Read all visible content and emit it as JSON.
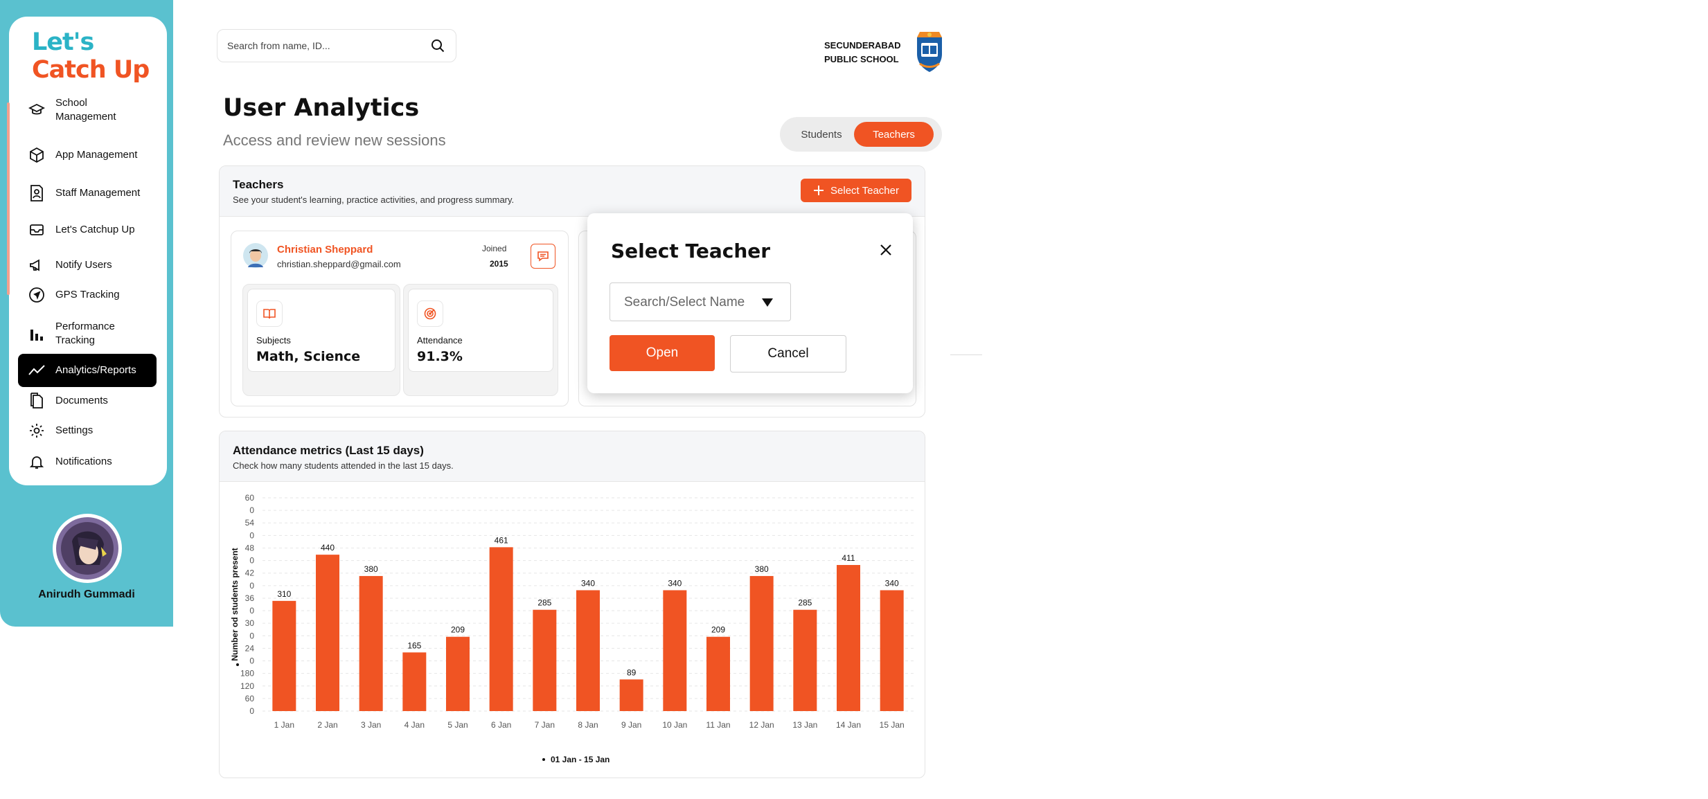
{
  "brand": {
    "line1": "Let's",
    "line2": "Catch Up"
  },
  "sidebar": {
    "items": [
      {
        "label": "School Management",
        "icon": "graduation-cap-icon"
      },
      {
        "label": "App Management",
        "icon": "cube-icon"
      },
      {
        "label": "Staff Management",
        "icon": "staff-badge-icon"
      },
      {
        "label": "Let's Catchup Up",
        "icon": "inbox-icon"
      },
      {
        "label": "Notify Users",
        "icon": "megaphone-icon"
      },
      {
        "label": "GPS Tracking",
        "icon": "navigation-icon"
      },
      {
        "label": "Performance Tracking",
        "icon": "bar-chart-icon"
      },
      {
        "label": "Analytics/Reports",
        "icon": "trend-line-icon",
        "active": true
      },
      {
        "label": "Documents",
        "icon": "documents-icon"
      },
      {
        "label": "Settings",
        "icon": "gear-icon"
      },
      {
        "label": "Notifications",
        "icon": "bell-icon"
      }
    ],
    "user": {
      "name": "Anirudh Gummadi"
    }
  },
  "header": {
    "search_placeholder": "Search from name, ID...",
    "school_line1": "SECUNDERABAD",
    "school_line2": "PUBLIC SCHOOL"
  },
  "page": {
    "title": "User Analytics",
    "subtitle": "Access and review new sessions",
    "toggle": {
      "option1": "Students",
      "option2": "Teachers",
      "selected": "Teachers"
    }
  },
  "teachers_panel": {
    "title": "Teachers",
    "description": "See your student's learning, practice activities, and progress summary.",
    "select_button": "Select Teacher",
    "teacher": {
      "name": "Christian Sheppard",
      "email": "christian.sheppard@gmail.com",
      "joined_label": "Joined",
      "joined_year": "2015",
      "subjects_label": "Subjects",
      "subjects_value": "Math, Science",
      "attendance_label": "Attendance",
      "attendance_value": "91.3%"
    }
  },
  "modal": {
    "title": "Select Teacher",
    "select_placeholder": "Search/Select Name",
    "open_label": "Open",
    "cancel_label": "Cancel"
  },
  "attendance_panel": {
    "title": "Attendance metrics (Last 15 days)",
    "description": "Check how many students attended in the last 15 days."
  },
  "colors": {
    "accent": "#f05423",
    "sidebar": "#5ac1cf",
    "brand_teal": "#2bb3c6"
  },
  "chart_data": {
    "type": "bar",
    "categories": [
      "1 Jan",
      "2 Jan",
      "3 Jan",
      "4 Jan",
      "5 Jan",
      "6 Jan",
      "7 Jan",
      "8 Jan",
      "9 Jan",
      "10 Jan",
      "11 Jan",
      "12 Jan",
      "13 Jan",
      "14 Jan",
      "15 Jan"
    ],
    "values": [
      310,
      440,
      380,
      165,
      209,
      461,
      285,
      340,
      89,
      340,
      209,
      380,
      285,
      411,
      340
    ],
    "value_labels": [
      "310",
      "440",
      "380",
      "165",
      "209",
      "461",
      "285",
      "340",
      "89",
      "340",
      "209",
      "380",
      "285",
      "411",
      "340"
    ],
    "y_tick_labels": [
      "0",
      "60",
      "120",
      "180",
      "0",
      "24",
      "0",
      "30",
      "0",
      "36",
      "0",
      "42",
      "0",
      "48",
      "0",
      "54",
      "0",
      "60"
    ],
    "ylabel": "Number od students present",
    "xlabel": "01 Jan - 15 Jan",
    "ylim": [
      0,
      600
    ],
    "grid": true,
    "bar_color": "#f05423"
  }
}
